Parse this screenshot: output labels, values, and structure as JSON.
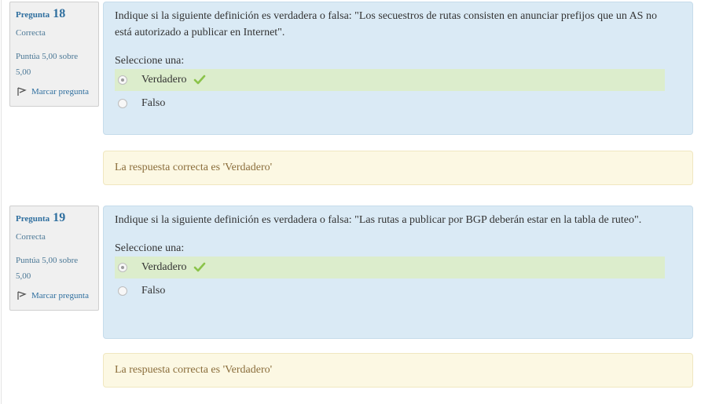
{
  "questions": [
    {
      "label": "Pregunta",
      "number": "18",
      "state": "Correcta",
      "grade": "Puntúa 5,00 sobre 5,00",
      "flag_label": "Marcar pregunta",
      "text": "Indique si la siguiente definición es verdadera o falsa: \"Los secuestros de rutas consisten en anunciar prefijos que un AS no está autorizado a publicar en Internet\".",
      "prompt": "Seleccione una:",
      "options": [
        {
          "label": "Verdadero",
          "selected": true,
          "correct": true
        },
        {
          "label": "Falso",
          "selected": false,
          "correct": false
        }
      ],
      "feedback": "La respuesta correcta es 'Verdadero'"
    },
    {
      "label": "Pregunta",
      "number": "19",
      "state": "Correcta",
      "grade": "Puntúa 5,00 sobre 5,00",
      "flag_label": "Marcar pregunta",
      "text": "Indique si la siguiente definición es verdadera o falsa: \"Las rutas a publicar por BGP deberán estar en la tabla de ruteo\".",
      "prompt": "Seleccione una:",
      "options": [
        {
          "label": "Verdadero",
          "selected": true,
          "correct": true
        },
        {
          "label": "Falso",
          "selected": false,
          "correct": false
        }
      ],
      "feedback": "La respuesta correcta es 'Verdadero'"
    }
  ],
  "colors": {
    "content_bg": "#daeaf5",
    "correct_bg": "#dcedcc",
    "feedback_bg": "#fcf8e3",
    "check": "#8bc34a"
  }
}
